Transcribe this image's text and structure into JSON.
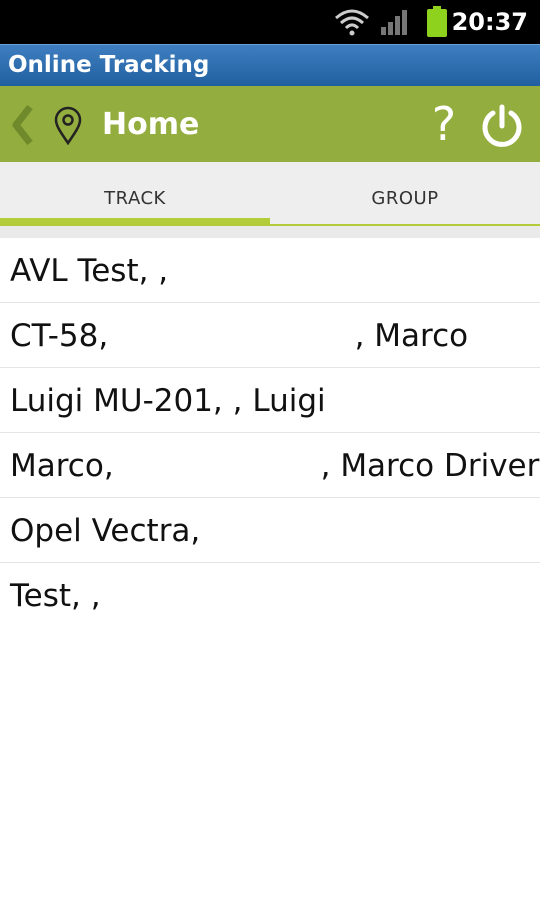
{
  "status_bar": {
    "time": "20:37",
    "icons": [
      "wifi-icon",
      "signal-icon",
      "battery-icon"
    ],
    "battery_color": "#8ed21e"
  },
  "app": {
    "title": "Online Tracking"
  },
  "action_bar": {
    "title": "Home",
    "help_glyph": "?",
    "background": "#94ad3f"
  },
  "tabs": [
    {
      "label": "TRACK",
      "selected": true
    },
    {
      "label": "GROUP",
      "selected": false
    }
  ],
  "list": {
    "items": [
      {
        "label": "AVL Test, ,"
      },
      {
        "label": "CT-58,                         , Marco"
      },
      {
        "label": "Luigi MU-201, , Luigi"
      },
      {
        "label": "Marco,                     , Marco Driver"
      },
      {
        "label": "Opel Vectra,"
      },
      {
        "label": "Test, ,"
      }
    ]
  },
  "colors": {
    "accent": "#b3cc3a",
    "title_bar": "#2f6fb0"
  }
}
